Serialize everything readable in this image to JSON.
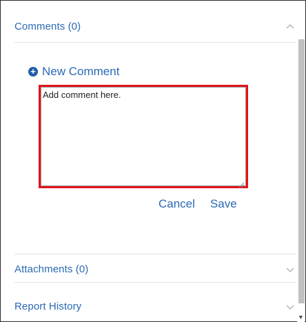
{
  "comments_section": {
    "title": "Comments (0)",
    "new_comment_label": "New Comment",
    "textarea": {
      "value": "",
      "placeholder": "Add comment here."
    },
    "cancel_label": "Cancel",
    "save_label": "Save"
  },
  "attachments_section": {
    "title": "Attachments (0)"
  },
  "report_history_section": {
    "title": "Report History"
  },
  "colors": {
    "link": "#2a69b4",
    "highlight_border": "#e4121b",
    "divider": "#e2e2e2"
  }
}
